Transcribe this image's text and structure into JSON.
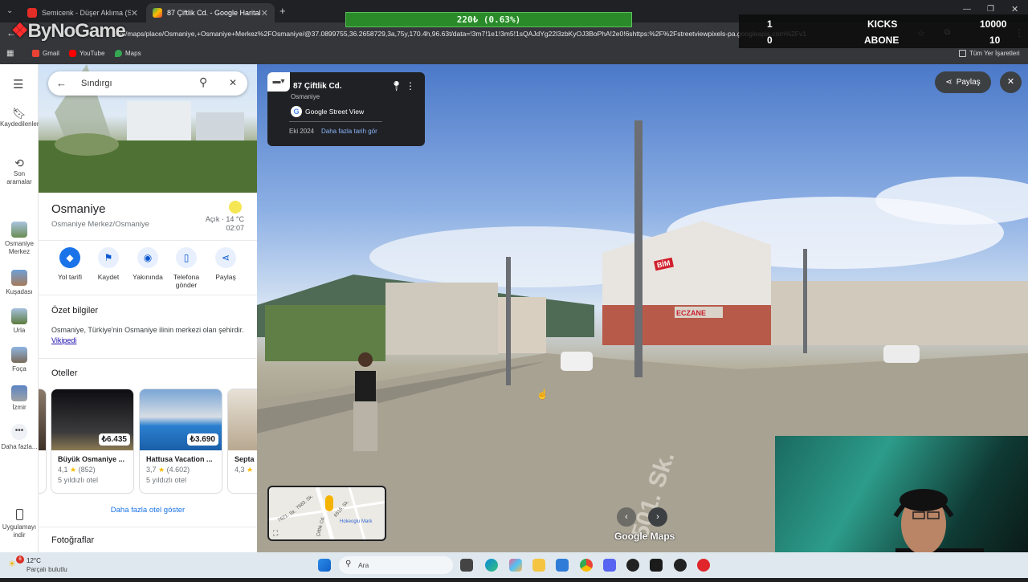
{
  "browser": {
    "tabs": [
      {
        "title": "Semicenk - Düşer Aklıma (Slow"
      },
      {
        "title": "87 Çiftlik Cd. - Google Haritalar"
      }
    ],
    "url": "com/maps/place/Osmaniye,+Osmaniye+Merkez%2FOsmaniye/@37.0899755,36.2658729,3a,75y,170.4h,96.63t/data=!3m7!1e1!3m5!1sQAJdYg22l3zbKyOJ3BoPhA!2e0!6shttps:%2F%2Fstreetviewpixels-pa.googleapis.com%2Fv1",
    "bookmarks": [
      "Gmail",
      "YouTube",
      "Maps"
    ],
    "all_bookmarks": "Tüm Yer İşaretleri"
  },
  "overlay": {
    "logo": "ByNoGame",
    "donation_bar": "220₺ (0.63%)",
    "kicks_label": "KICKS",
    "abone_label": "ABONE",
    "kicks_left": "1",
    "kicks_right": "10000",
    "abone_left": "0",
    "abone_right": "10"
  },
  "rail": {
    "items": [
      {
        "label": "Kaydedilenler",
        "icon": "bookmark-icon"
      },
      {
        "label": "Son aramalar",
        "icon": "history-icon"
      },
      {
        "label": "Osmaniye Merkez",
        "icon": "place-thumbnail"
      },
      {
        "label": "Kuşadası",
        "icon": "place-thumbnail"
      },
      {
        "label": "Urla",
        "icon": "place-thumbnail"
      },
      {
        "label": "Foça",
        "icon": "place-thumbnail"
      },
      {
        "label": "İzmir",
        "icon": "place-thumbnail"
      },
      {
        "label": "Daha fazla...",
        "icon": "more-icon"
      }
    ],
    "bottom_item": "Uygulamayı indir"
  },
  "search": {
    "value": "Sındırgı"
  },
  "place": {
    "name": "Osmaniye",
    "subtitle": "Osmaniye Merkez/Osmaniye",
    "weather_status": "Açık · 14 °C",
    "time": "02:07",
    "actions": [
      "Yol tarifi",
      "Kaydet",
      "Yakınında",
      "Telefona gönder",
      "Paylaş"
    ],
    "summary_title": "Özet bilgiler",
    "summary_text": "Osmaniye, Türkiye'nin Osmaniye ilinin merkezi olan şehirdir.",
    "summary_link": "Vikipedi",
    "hotels_title": "Oteller",
    "hotels": [
      {
        "name": "Büyük Osmaniye ...",
        "price": "₺6.435",
        "rating": "4,1",
        "reviews": "(852)",
        "class": "5 yıldızlı otel"
      },
      {
        "name": "Hattusa Vacation ...",
        "price": "₺3.690",
        "rating": "3,7",
        "reviews": "(4.602)",
        "class": "5 yıldızlı otel"
      },
      {
        "name": "Septa",
        "rating": "4,3"
      }
    ],
    "more_hotels": "Daha fazla otel göster",
    "photos_title": "Fotoğraflar"
  },
  "streetview": {
    "address": "87 Çiftlik Cd.",
    "city": "Osmaniye",
    "brand": "Google Street View",
    "date": "Eki 2024",
    "more_dates": "Daha fazla tarih gör",
    "share": "Paylaş",
    "watermark": "Google Maps",
    "street_sign": "501. Sk.",
    "shop_sign": "ECZANE",
    "bim_sign": "BİM",
    "minimap_labels": [
      "7621. Sk.",
      "6515. Sk.",
      "Çiftlik Cd.",
      "Hokeoglu Mark",
      "7683. Sk."
    ]
  },
  "taskbar": {
    "weather_temp": "12°C",
    "weather_desc": "Parçalı bulutlu",
    "search": "Ara",
    "badge": "6"
  }
}
